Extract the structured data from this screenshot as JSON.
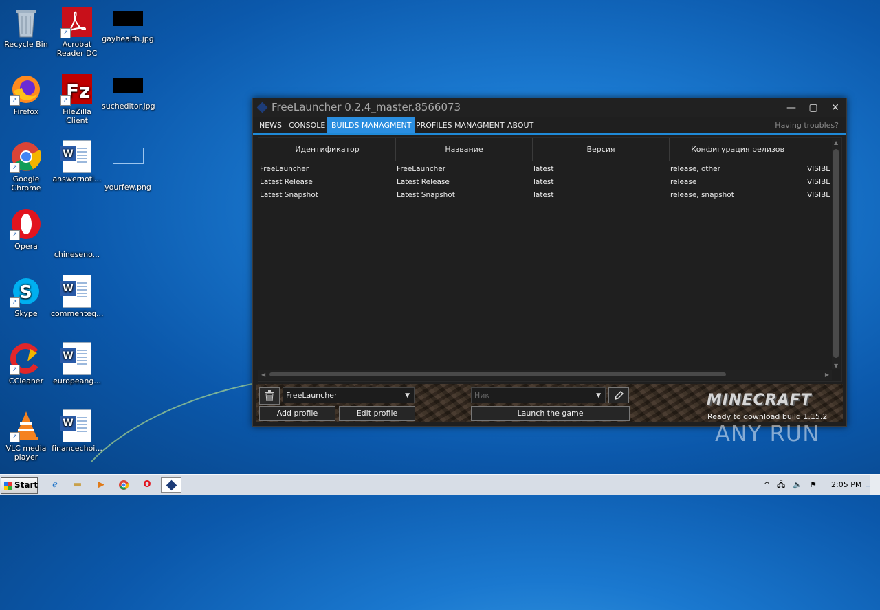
{
  "desktop": {
    "icons": [
      {
        "label": "Recycle Bin",
        "icon": "recycle-bin-icon"
      },
      {
        "label": "Acrobat Reader DC",
        "icon": "acrobat-icon"
      },
      {
        "label": "gayhealth.jpg",
        "icon": "image-file-icon"
      },
      {
        "label": "Firefox",
        "icon": "firefox-icon"
      },
      {
        "label": "FileZilla Client",
        "icon": "filezilla-icon"
      },
      {
        "label": "sucheditor.jpg",
        "icon": "image-file-icon"
      },
      {
        "label": "Google Chrome",
        "icon": "chrome-icon"
      },
      {
        "label": "answernoti...",
        "icon": "word-doc-icon"
      },
      {
        "label": "yourfew.png",
        "icon": "image-file-icon"
      },
      {
        "label": "Opera",
        "icon": "opera-icon"
      },
      {
        "label": "chineseno...",
        "icon": "file-icon"
      },
      {
        "label": "Skype",
        "icon": "skype-icon"
      },
      {
        "label": "commenteq...",
        "icon": "word-doc-icon"
      },
      {
        "label": "CCleaner",
        "icon": "ccleaner-icon"
      },
      {
        "label": "europeang...",
        "icon": "word-doc-icon"
      },
      {
        "label": "VLC media player",
        "icon": "vlc-icon"
      },
      {
        "label": "financechoi...",
        "icon": "word-doc-icon"
      }
    ],
    "watermark": "ANY RUN"
  },
  "window": {
    "title": "FreeLauncher 0.2.4_master.8566073",
    "controls": {
      "minimize": "—",
      "maximize": "▢",
      "close": "✕"
    },
    "menu": [
      {
        "label": "NEWS",
        "active": false
      },
      {
        "label": "CONSOLE",
        "active": false
      },
      {
        "label": "BUILDS MANAGMENT",
        "active": true
      },
      {
        "label": "PROFILES MANAGMENT",
        "active": false
      },
      {
        "label": "ABOUT",
        "active": false
      }
    ],
    "help_link": "Having troubles?",
    "table": {
      "columns": [
        "Идентификатор",
        "Название",
        "Версия",
        "Конфигурация релизов",
        ""
      ],
      "rows": [
        [
          "FreeLauncher",
          "FreeLauncher",
          "latest",
          "release, other",
          "VISIBL"
        ],
        [
          "Latest Release",
          "Latest Release",
          "latest",
          "release",
          "VISIBL"
        ],
        [
          "Latest Snapshot",
          "Latest Snapshot",
          "latest",
          "release, snapshot",
          "VISIBL"
        ]
      ]
    },
    "bottom": {
      "profile_select": "FreeLauncher",
      "nick_placeholder": "Ник",
      "add_profile": "Add profile",
      "edit_profile": "Edit profile",
      "launch": "Launch the game",
      "logo": "MINECRAFT",
      "status": "Ready to download build 1.15.2"
    }
  },
  "taskbar": {
    "start_label": "Start",
    "clock": "2:05 PM",
    "tray_chevron": "^"
  }
}
